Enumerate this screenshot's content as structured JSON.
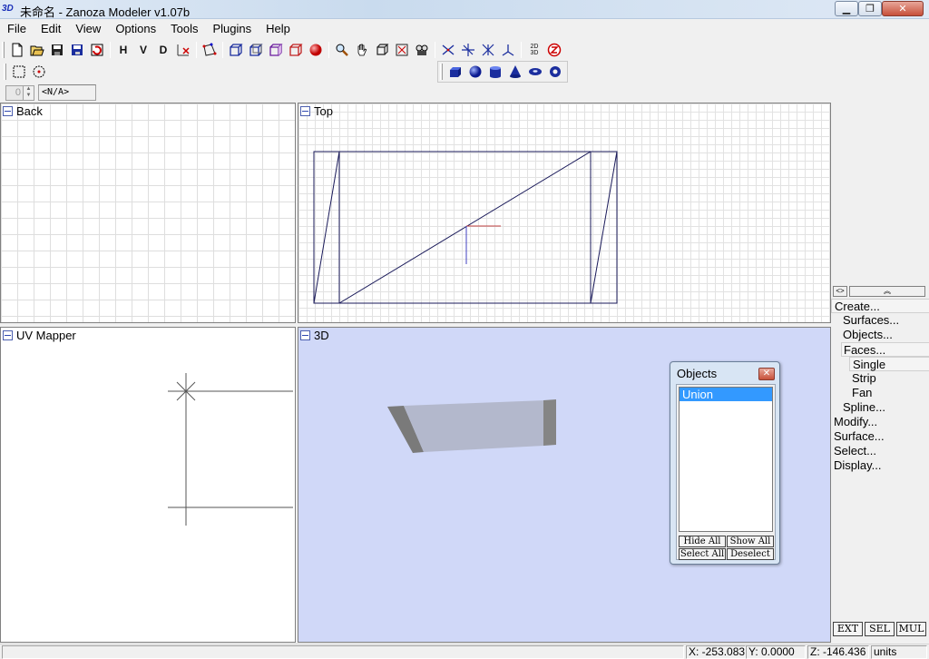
{
  "window": {
    "icon_text": "3D",
    "title": "未命名 - Zanoza Modeler v1.07b",
    "min_glyph": "▁",
    "max_glyph": "❐",
    "close_glyph": "✕"
  },
  "menu": [
    "File",
    "Edit",
    "View",
    "Options",
    "Tools",
    "Plugins",
    "Help"
  ],
  "toolbar": {
    "h_label": "H",
    "v_label": "V",
    "d_label": "D",
    "icons": [
      "new-icon",
      "open-icon",
      "save-icon",
      "save-as-icon",
      "revert-icon",
      "view-h",
      "view-v",
      "view-d",
      "reset-view-icon",
      "select-vertex-icon",
      "cube-front-icon",
      "cube-back-icon",
      "cube-side-icon",
      "cube-red-icon",
      "render-sphere-icon",
      "zoom-icon",
      "pan-hand-icon",
      "orbit-cube-icon",
      "fit-view-icon",
      "camera-icon",
      "move-icon",
      "rotate-icon",
      "scale-icon",
      "axis-icon",
      "2d-3d-icon",
      "z-icon"
    ],
    "text_2d3d": "2D\n3D",
    "z_label": "Z",
    "primitives": [
      "box-icon",
      "sphere-icon",
      "cylinder-icon",
      "cone-icon",
      "torus-icon",
      "ring-icon"
    ]
  },
  "spinner": {
    "value": "0",
    "na_text": "<N/A>"
  },
  "viewports": {
    "back": "Back",
    "top": "Top",
    "uv": "UV Mapper",
    "three_d": "3D"
  },
  "colors": {
    "viewport_3d_bg": "#d0d8f8",
    "mesh_face": "#b3b8cc",
    "mesh_edge": "#808080",
    "wire": "#1a1a5a",
    "axis_x": "#c04040",
    "axis_y": "#4040c0",
    "selection_blue": "#3399ff"
  },
  "panel": {
    "toggle_glyph": "<>",
    "collapse_glyph": "︽",
    "tree": [
      {
        "label": "Create...",
        "level": 0,
        "selected": true
      },
      {
        "label": "Surfaces...",
        "level": 1,
        "selected": false
      },
      {
        "label": "Objects...",
        "level": 1,
        "selected": false
      },
      {
        "label": "Faces...",
        "level": 1,
        "selected": true
      },
      {
        "label": "Single",
        "level": 2,
        "selected": true
      },
      {
        "label": "Strip",
        "level": 2,
        "selected": false
      },
      {
        "label": "Fan",
        "level": 2,
        "selected": false
      },
      {
        "label": "Spline...",
        "level": 1,
        "selected": false
      },
      {
        "label": "Modify...",
        "level": 0,
        "selected": false
      },
      {
        "label": "Surface...",
        "level": 0,
        "selected": false
      },
      {
        "label": "Select...",
        "level": 0,
        "selected": false
      },
      {
        "label": "Display...",
        "level": 0,
        "selected": false
      }
    ],
    "mode_buttons": [
      "EXT",
      "SEL",
      "MUL"
    ]
  },
  "objects_window": {
    "title": "Objects",
    "items": [
      "Union"
    ],
    "hide_all": "Hide All",
    "show_all": "Show All",
    "select_all": "Select All",
    "deselect": "Deselect"
  },
  "status": {
    "x": "X: -253.083",
    "y": "Y: 0.0000",
    "z": "Z: -146.436",
    "units": "units"
  }
}
